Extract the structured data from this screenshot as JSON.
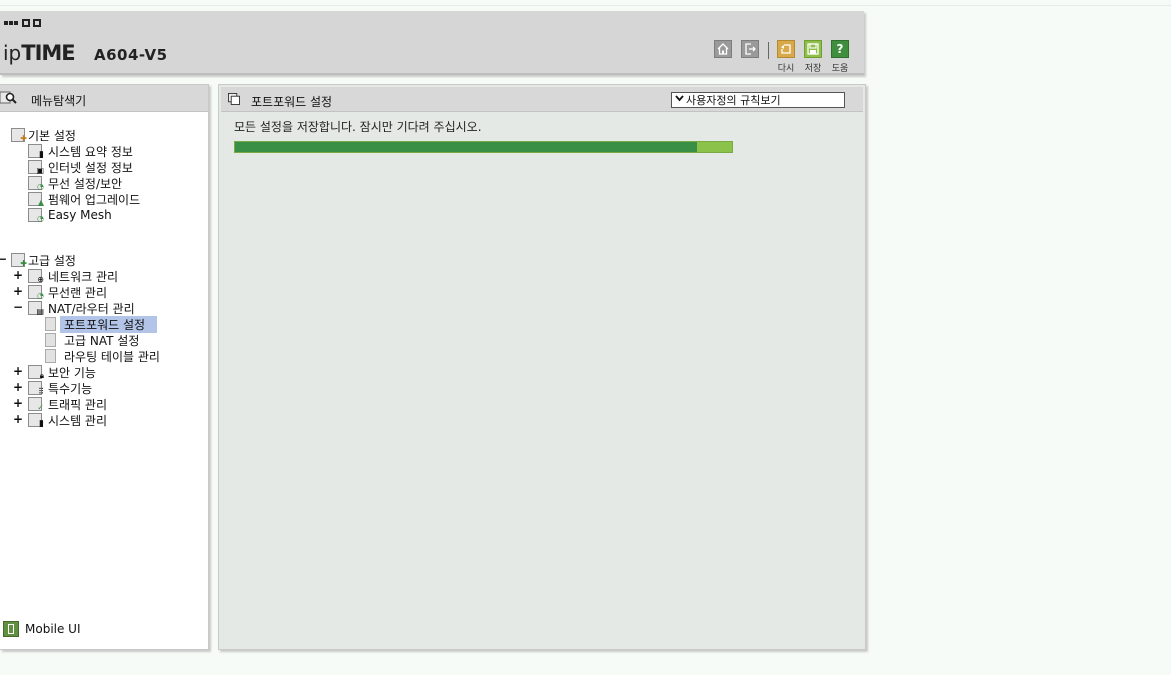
{
  "header": {
    "brand_ip": "ip",
    "brand_time": "TIME",
    "model": "A604-V5",
    "buttons": [
      {
        "name": "home",
        "icon": "home-icon"
      },
      {
        "name": "logout",
        "icon": "logout-icon"
      },
      {
        "name": "undo",
        "icon": "undo-icon",
        "label": "다시"
      },
      {
        "name": "save",
        "icon": "save-icon",
        "label": "저장"
      },
      {
        "name": "help",
        "icon": "help-icon",
        "label": "도움",
        "glyph": "?"
      }
    ]
  },
  "sidebar": {
    "title": "메뉴탐색기",
    "sections": [
      {
        "label": "기본 설정",
        "items": [
          "시스템 요약 정보",
          "인터넷 설정 정보",
          "무선 설정/보안",
          "펌웨어 업그레이드",
          "Easy Mesh"
        ]
      },
      {
        "label": "고급 설정",
        "collapse_glyph": "−",
        "items": [
          {
            "label": "네트워크 관리",
            "glyph": "+"
          },
          {
            "label": "무선랜 관리",
            "glyph": "+"
          },
          {
            "label": "NAT/라우터 관리",
            "glyph": "−",
            "children": [
              "포트포워드 설정",
              "고급 NAT 설정",
              "라우팅 테이블 관리"
            ],
            "selected_child": 0
          },
          {
            "label": "보안 기능",
            "glyph": "+"
          },
          {
            "label": "특수기능",
            "glyph": "+"
          },
          {
            "label": "트래픽 관리",
            "glyph": "+"
          },
          {
            "label": "시스템 관리",
            "glyph": "+"
          }
        ]
      }
    ],
    "mobile_label": "Mobile UI"
  },
  "main": {
    "title": "포트포워드 설정",
    "view_select": "사용자정의 규칙보기",
    "message": "모든 설정을 저장합니다. 잠시만 기다려 주십시오.",
    "progress": 0.93
  },
  "colors": {
    "accent_green": "#3a8f47",
    "progress_remaining": "#8bc34a",
    "selection": "#b2c4e8"
  }
}
